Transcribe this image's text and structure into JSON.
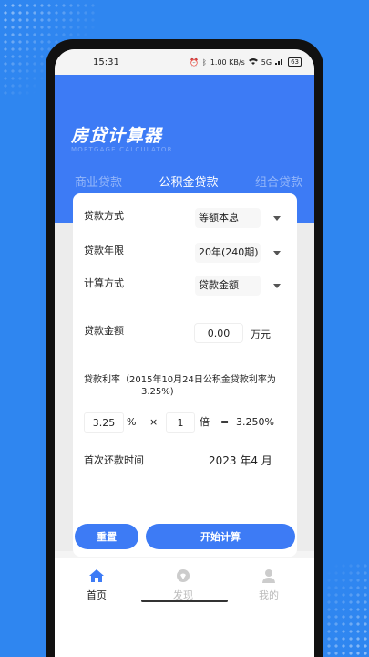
{
  "status": {
    "time": "15:31",
    "net_speed": "1.00 KB/s",
    "signal": "5G",
    "battery": "63"
  },
  "header": {
    "title": "房贷计算器",
    "subtitle": "MORTGAGE CALCULATOR"
  },
  "tabs": [
    {
      "label": "商业贷款"
    },
    {
      "label": "公积金贷款"
    },
    {
      "label": "组合贷款"
    }
  ],
  "form": {
    "method": {
      "label": "贷款方式",
      "value": "等额本息"
    },
    "term": {
      "label": "贷款年限",
      "value": "20年(240期)"
    },
    "calc_method": {
      "label": "计算方式",
      "value": "贷款金额"
    },
    "amount": {
      "label": "贷款金额",
      "value": "0.00",
      "unit": "万元"
    },
    "rate": {
      "label": "贷款利率（2015年10月24日公积金贷款利率为",
      "label_cont": "3.25%)",
      "base": "3.25",
      "percent": "%",
      "times": "×",
      "multiplier": "1",
      "multiplier_unit": "倍",
      "equals": "=",
      "result": "3.250%"
    },
    "first_payment": {
      "label": "首次还款时间",
      "value": "2023 年4 月"
    }
  },
  "buttons": {
    "reset": "重置",
    "calculate": "开始计算"
  },
  "nav": [
    {
      "label": "首页"
    },
    {
      "label": "发现"
    },
    {
      "label": "我的"
    }
  ],
  "colors": {
    "primary": "#3d7bf5",
    "background": "#2f86f0"
  }
}
